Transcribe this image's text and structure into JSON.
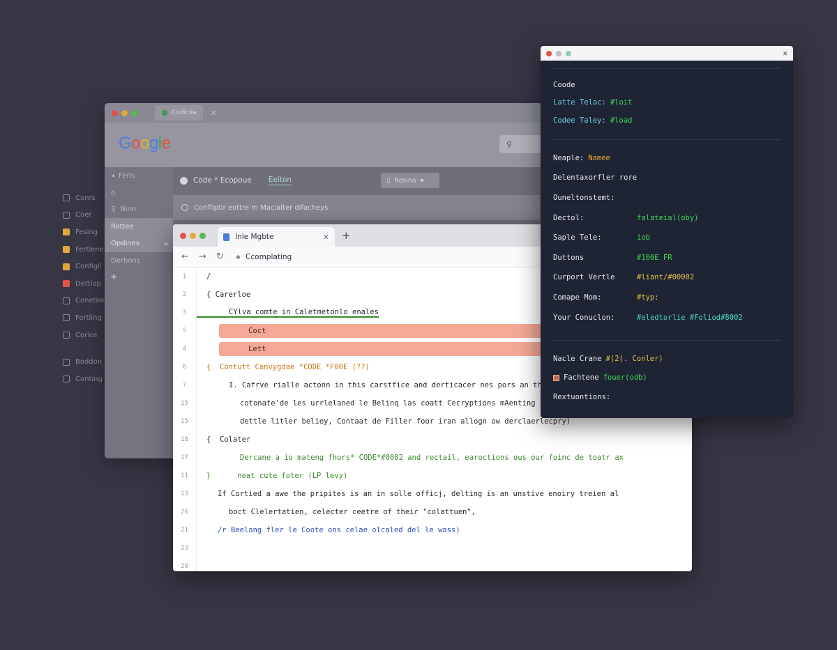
{
  "ghost_list": [
    {
      "label": "Conrs",
      "color": "#8c8a98"
    },
    {
      "label": "Coer",
      "color": "#8c8a98"
    },
    {
      "label": "Fesing",
      "color": "#e2a93a"
    },
    {
      "label": "Fertlene",
      "color": "#e2a93a"
    },
    {
      "label": "Configli",
      "color": "#e2a93a"
    },
    {
      "label": "Dettiop",
      "color": "#e0534a"
    },
    {
      "label": "Conetion",
      "color": "#8c8a98"
    },
    {
      "label": "Fortling",
      "color": "#8c8a98"
    },
    {
      "label": "Corice",
      "color": "#8c8a98"
    },
    {
      "label": "Boddon",
      "color": "#8c8a98"
    },
    {
      "label": "Conting",
      "color": "#8c8a98"
    }
  ],
  "back_browser": {
    "tab_label": "Codiclia",
    "search_icon": "search-icon",
    "sidebar": [
      {
        "label": "Ferls",
        "icon": "arrow-left-icon",
        "active": false
      },
      {
        "label": "",
        "icon": "home-icon",
        "active": false
      },
      {
        "label": "Ninn",
        "icon": "pin-icon",
        "active": false
      },
      {
        "label": "Rottee",
        "icon": "",
        "active": true
      },
      {
        "label": "Opdines",
        "icon": "",
        "active": true,
        "chevron": true
      },
      {
        "label": "Derbons",
        "icon": "",
        "active": false
      },
      {
        "label": "",
        "icon": "puzzle-icon",
        "active": false
      }
    ],
    "toolbar": {
      "title": "Code * Ecopoue",
      "edit": "Eelton",
      "pill": "Rosino"
    },
    "notice": "Confliptir eottre m Macialter difacheys"
  },
  "google_logo": {
    "letters": [
      {
        "ch": "G",
        "color": "#4a7fe0"
      },
      {
        "ch": "o",
        "color": "#e0534a"
      },
      {
        "ch": "o",
        "color": "#e2b32a"
      },
      {
        "ch": "g",
        "color": "#4a7fe0"
      },
      {
        "ch": "l",
        "color": "#3aa557"
      },
      {
        "ch": "e",
        "color": "#e0534a"
      }
    ]
  },
  "front_browser": {
    "tab_label": "Inle Mgbte",
    "address": "Ccomplating",
    "lines": [
      {
        "n": "1",
        "text": "/",
        "cls": "",
        "indent": 0
      },
      {
        "n": "2",
        "text": "{ Carerloe",
        "cls": "",
        "indent": 0
      },
      {
        "n": "3",
        "text": "CYlva comte in Caletmetonlo enales",
        "cls": "",
        "indent": 2,
        "underline": true
      },
      {
        "n": "5",
        "text": "Coct",
        "cls": "hl",
        "indent": 0
      },
      {
        "n": "4",
        "text": "Lett",
        "cls": "hl",
        "indent": 0
      },
      {
        "n": "6",
        "text": "{  Contutt Canvygdae *CODE *F00E (??)",
        "cls": "c-orange",
        "indent": 0
      },
      {
        "n": "7",
        "text": "I. Cafrve rialle actonn in this carstfice and derticacer nes pors an the",
        "cls": "",
        "indent": 2
      },
      {
        "n": "15",
        "text": "cotonate'de les urrlelaned le Belinq las coatt Cecryptions mAenting",
        "cls": "",
        "indent": 3
      },
      {
        "n": "15",
        "text": "dettle litler beliey, Contaat de Filler foor iran allogn ow derclaerlecpry)",
        "cls": "",
        "indent": 3
      },
      {
        "n": "18",
        "text": "{  Colater",
        "cls": "",
        "indent": 0
      },
      {
        "n": "17",
        "text": "Dercane a io mateng fhors* CODE*#0002 and rectail, earoctions ous our foinc de toatr ax",
        "cls": "c-green",
        "indent": 3
      },
      {
        "n": "11",
        "text": "}      neat cute foter (LP levy)",
        "cls": "c-green",
        "indent": 0
      },
      {
        "n": "13",
        "text": "If Cortied a awe the pripites is an in solle officj, delting is an unstive enoiry treien al",
        "cls": "",
        "indent": 1
      },
      {
        "n": "26",
        "text": "boct Clelertatien, celecter ceetre of their \"colattuen\",",
        "cls": "",
        "indent": 2
      },
      {
        "n": "21",
        "text": "/r Beelang fler le Coote ons celae olcaled del le wass)",
        "cls": "c-blue",
        "indent": 1
      },
      {
        "n": "23",
        "text": "",
        "cls": "",
        "indent": 0
      },
      {
        "n": "28",
        "text": "",
        "cls": "",
        "indent": 0
      }
    ]
  },
  "dark_window": {
    "rows_a": [
      {
        "k": "Coode",
        "v": "",
        "vc": ""
      },
      {
        "k": "Latte Telac:",
        "v": "#loit",
        "vc": "g",
        "kc": "lb"
      },
      {
        "k": "Codee Taley:",
        "v": "#load",
        "vc": "g",
        "kc": "lb"
      }
    ],
    "rows_b": [
      {
        "k": "Neaple:",
        "v": "Namee",
        "vc": "o"
      },
      {
        "k": "Delentaxorfler rore",
        "v": "",
        "vc": ""
      },
      {
        "k": "Ouneltonstemt:",
        "v": "",
        "vc": ""
      },
      {
        "k": "Dectol:",
        "v": "falateial(oby)",
        "vc": "g",
        "tab": true
      },
      {
        "k": "Saple Tele:",
        "v": "iob",
        "vc": "g",
        "tab": true
      },
      {
        "k": "Duttons",
        "v": "#100E FR",
        "vc": "g",
        "tab": true
      },
      {
        "k": "Curport Vertle",
        "v": "#liant/#00002",
        "vc": "y",
        "tab": true
      },
      {
        "k": "Comape Mom:",
        "v": "#typ:",
        "vc": "y",
        "tab": true
      },
      {
        "k": "Your Conuclon:",
        "v": "#eledtorlie #Foliod#8002",
        "vc": "t",
        "tab": true
      }
    ],
    "rows_c": [
      {
        "k": "Nacle Crane",
        "v": "#(2(. Conler)",
        "vc": "y2"
      },
      {
        "k": "Fachtene",
        "v": "fouer(odb)",
        "vc": "g",
        "check": true
      },
      {
        "k": "Rextuontions:",
        "v": "",
        "vc": ""
      }
    ]
  }
}
